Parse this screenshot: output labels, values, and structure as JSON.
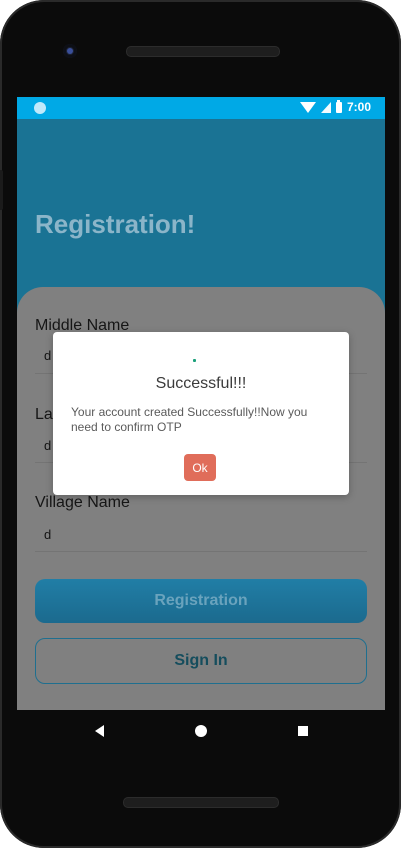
{
  "status_bar": {
    "time": "7:00"
  },
  "header": {
    "title": "Registration!"
  },
  "form": {
    "fields": [
      {
        "label": "Middle Name",
        "value": "d"
      },
      {
        "label": "La",
        "value": "d"
      },
      {
        "label": "Village Name",
        "value": "d"
      }
    ],
    "register_button": "Registration",
    "signin_button": "Sign In"
  },
  "dialog": {
    "title": "Successful!!!",
    "message": "Your account created Successfully!!Now you need to confirm OTP",
    "ok_label": "Ok"
  },
  "colors": {
    "accent": "#00a9e6",
    "header_bg": "#1a7394",
    "dialog_ok": "#e06d5a"
  }
}
